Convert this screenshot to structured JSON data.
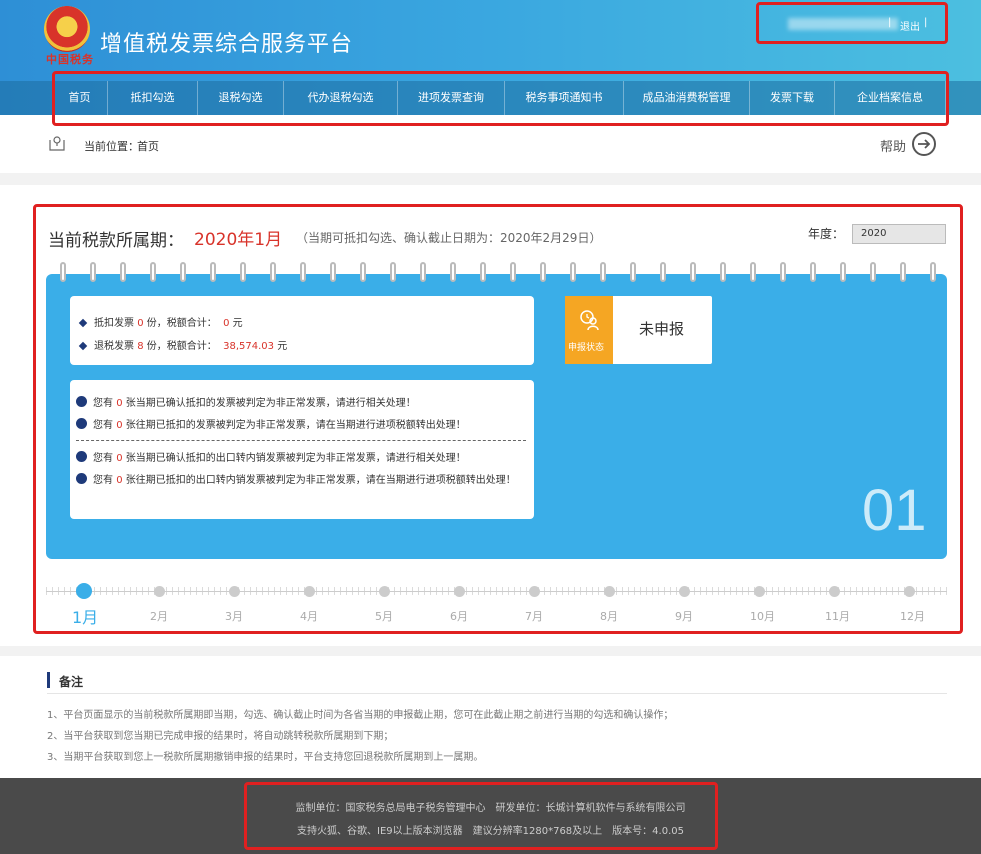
{
  "header": {
    "emblem_text": "中国税务",
    "title": "增值税发票综合服务平台",
    "user_sep": "|",
    "logout_label": "退出"
  },
  "nav": {
    "items": [
      "首页",
      "抵扣勾选",
      "退税勾选",
      "代办退税勾选",
      "进项发票查询",
      "税务事项通知书",
      "成品油消费税管理",
      "发票下载",
      "企业档案信息"
    ]
  },
  "breadcrumb": {
    "label": "当前位置：",
    "value": "首页",
    "help_label": "帮助"
  },
  "period": {
    "label": "当前税款所属期：",
    "value": "2020年1月",
    "note": "（当期可抵扣勾选、确认截止日期为：2020年2月29日）",
    "year_label": "年度：",
    "year_value": "2020"
  },
  "summary": {
    "deduct_label": "抵扣发票",
    "deduct_count": "0",
    "deduct_unit": "份，税额合计：",
    "deduct_amount": "0",
    "deduct_currency": "元",
    "refund_label": "退税发票",
    "refund_count": "8",
    "refund_unit": "份，税额合计：",
    "refund_amount": "38,574.03",
    "refund_currency": "元"
  },
  "declare_status": {
    "label": "申报状态",
    "value": "未申报"
  },
  "alerts": [
    {
      "pre": "您有",
      "count": "0",
      "post": "张当期已确认抵扣的发票被判定为非正常发票，请进行相关处理！"
    },
    {
      "pre": "您有",
      "count": "0",
      "post": "张往期已抵扣的发票被判定为非正常发票，请在当期进行进项税额转出处理！"
    },
    {
      "pre": "您有",
      "count": "0",
      "post": "张当期已确认抵扣的出口转内销发票被判定为非正常发票，请进行相关处理！"
    },
    {
      "pre": "您有",
      "count": "0",
      "post": "张往期已抵扣的出口转内销发票被判定为非正常发票，请在当期进行进项税额转出处理！"
    }
  ],
  "big_number": "01",
  "months": [
    "1月",
    "2月",
    "3月",
    "4月",
    "5月",
    "6月",
    "7月",
    "8月",
    "9月",
    "10月",
    "11月",
    "12月"
  ],
  "notes": {
    "title": "备注",
    "items": [
      "1、平台页面显示的当前税款所属期即当期，勾选、确认截止时间为各省当期的申报截止期，您可在此截止期之前进行当期的勾选和确认操作；",
      "2、当平台获取到您当期已完成申报的结果时，将自动跳转税款所属期到下期；",
      "3、当期平台获取到您上一税款所属期撤销申报的结果时，平台支持您回退税款所属期到上一属期。"
    ]
  },
  "footer": {
    "line1": "监制单位：国家税务总局电子税务管理中心　研发单位：长城计算机软件与系统有限公司",
    "line2": "支持火狐、谷歌、IE9以上版本浏览器　建议分辨率1280*768及以上　版本号：4.0.05"
  }
}
